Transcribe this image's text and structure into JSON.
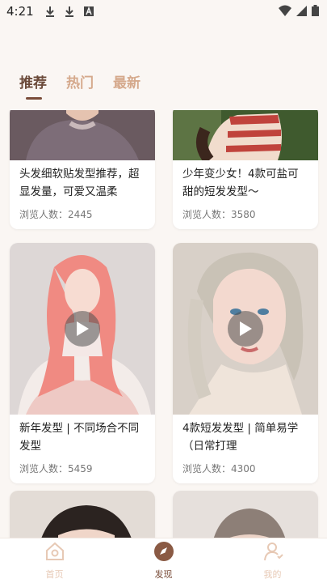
{
  "status": {
    "time": "4:21"
  },
  "tabs": [
    {
      "label": "推荐",
      "active": true
    },
    {
      "label": "热门",
      "active": false
    },
    {
      "label": "最新",
      "active": false
    }
  ],
  "cards": [
    {
      "title": "头发细软贴发型推荐，超显发量，可爱又温柔",
      "views": "浏览人数：2445",
      "video": false
    },
    {
      "title": "少年变少女！4款可盐可甜的短发发型～",
      "views": "浏览人数：3580",
      "video": false
    },
    {
      "title": "新年发型 | 不同场合不同发型",
      "views": "浏览人数：5459",
      "video": true
    },
    {
      "title": "4款短发发型 | 简单易学（日常打理",
      "views": "浏览人数：4300",
      "video": true
    }
  ],
  "nav": [
    {
      "label": "首页",
      "icon": "house-icon",
      "active": false
    },
    {
      "label": "发现",
      "icon": "compass-icon",
      "active": true
    },
    {
      "label": "我的",
      "icon": "user-icon",
      "active": false
    }
  ],
  "colors": {
    "accent": "#7a4d3a",
    "inactive_tab": "#d5a98c",
    "bg": "#faf6f3"
  }
}
